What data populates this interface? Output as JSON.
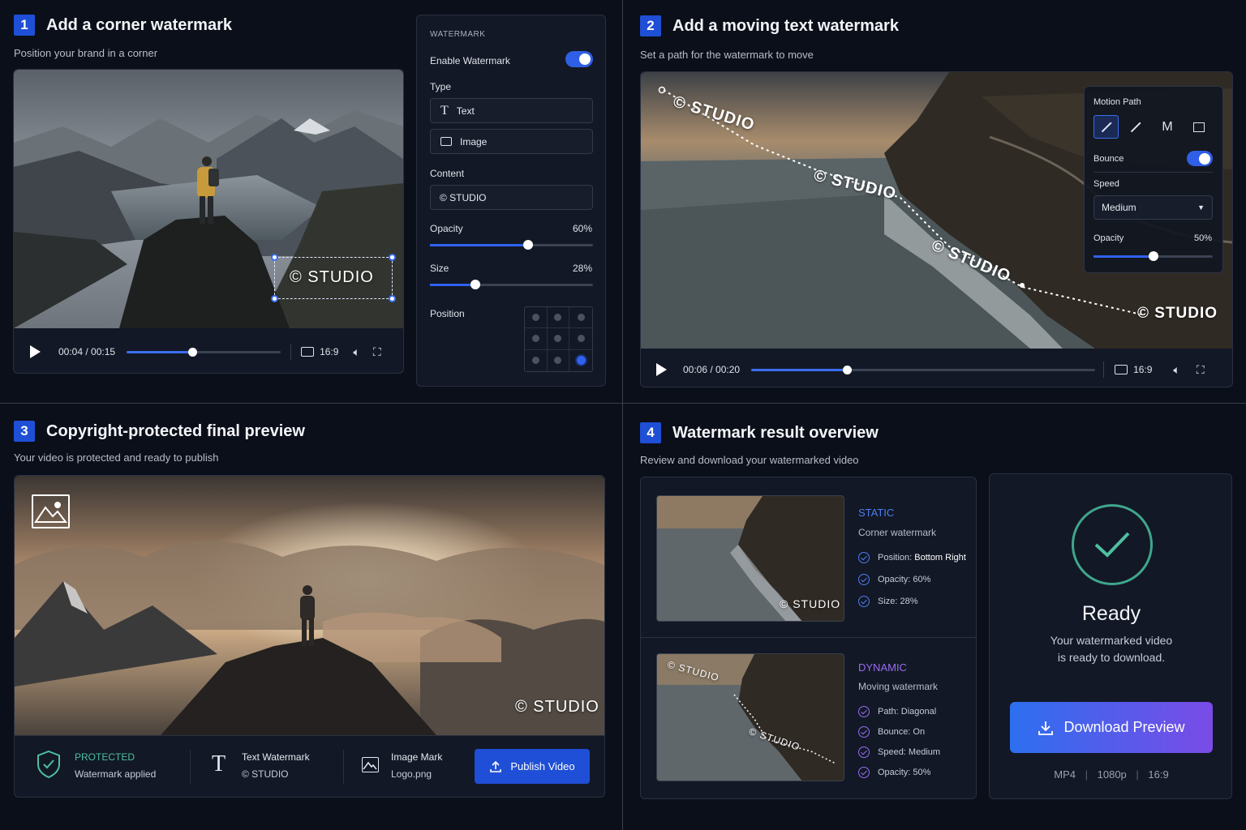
{
  "colors": {
    "accent": "#2f62f0",
    "purple": "#9a6bf0",
    "success": "#4fbfa0"
  },
  "q1": {
    "num": "1",
    "title": "Add a corner watermark",
    "subtitle": "Position your brand in a corner",
    "watermark_text": "© STUDIO",
    "time": "00:04 / 00:15",
    "progress": 0.43,
    "aspect": "16:9",
    "panel": {
      "heading": "WATERMARK",
      "enable_label": "Enable Watermark",
      "enabled": true,
      "type_label": "Type",
      "type_text": "Text",
      "type_image": "Image",
      "content_label": "Content",
      "content_value": "© STUDIO",
      "opacity_label": "Opacity",
      "opacity_value": "60%",
      "opacity": 0.6,
      "size_label": "Size",
      "size_value": "28%",
      "size": 0.28,
      "position_label": "Position",
      "position_selected": "bottom-right"
    }
  },
  "q2": {
    "num": "2",
    "title": "Add a moving text watermark",
    "subtitle": "Set a path for the watermark to move",
    "watermarks": [
      "© STUDIO",
      "© STUDIO",
      "© STUDIO",
      "© STUDIO"
    ],
    "time": "00:06 / 00:20",
    "progress": 0.28,
    "aspect": "16:9",
    "panel": {
      "heading": "Motion Path",
      "bounce_label": "Bounce",
      "bounce": true,
      "speed_label": "Speed",
      "speed_value": "Medium",
      "opacity_label": "Opacity",
      "opacity_value": "50%",
      "opacity": 0.5
    }
  },
  "q3": {
    "num": "3",
    "title": "Copyright-protected final preview",
    "subtitle": "Your video is protected and ready to publish",
    "watermark_text": "© STUDIO",
    "status_title": "PROTECTED",
    "status_sub": "Watermark applied",
    "text_wm_title": "Text Watermark",
    "text_wm_value": "© STUDIO",
    "image_mark_title": "Image Mark",
    "image_mark_value": "Logo.png",
    "publish_label": "Publish Video"
  },
  "q4": {
    "num": "4",
    "title": "Watermark result overview",
    "subtitle": "Review and download your watermarked video",
    "static": {
      "tag": "STATIC",
      "desc": "Corner watermark",
      "wm": "© STUDIO",
      "items": [
        {
          "k": "Position: ",
          "v": "Bottom Right"
        },
        {
          "k": "Opacity: ",
          "v": "60%"
        },
        {
          "k": "Size: ",
          "v": "28%"
        }
      ]
    },
    "dynamic": {
      "tag": "DYNAMIC",
      "desc": "Moving watermark",
      "wm1": "© STUDIO",
      "wm2": "© STUDIO",
      "items": [
        {
          "k": "Path: ",
          "v": "Diagonal"
        },
        {
          "k": "Bounce: ",
          "v": "On"
        },
        {
          "k": "Speed: ",
          "v": "Medium"
        },
        {
          "k": "Opacity: ",
          "v": "50%"
        }
      ]
    },
    "ready": {
      "title": "Ready",
      "line1": "Your watermarked video",
      "line2": "is ready to download.",
      "download_label": "Download Preview",
      "format": "MP4",
      "resolution": "1080p",
      "aspect": "16:9"
    }
  }
}
